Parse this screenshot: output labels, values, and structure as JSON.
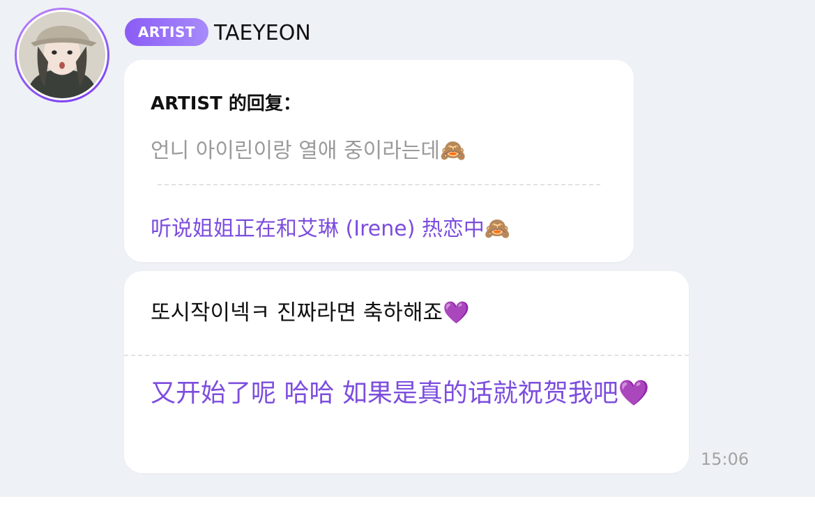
{
  "header": {
    "badge": "ARTIST",
    "name": "TAEYEON"
  },
  "reply": {
    "title": "ARTIST 的回复：",
    "original": "언니 아이린이랑 열애 중이라는데🙈",
    "translation": "听说姐姐正在和艾琳 (Irene) 热恋中🙈"
  },
  "message": {
    "original": "또시작이넥ㅋ 진짜라면 축하해죠💜",
    "translation": "又开始了呢 哈哈 如果是真的话就祝贺我吧💜",
    "time": "15:06"
  },
  "colors": {
    "badge_start": "#8b5cf6",
    "badge_end": "#a78bfa",
    "translation": "#7c4dde",
    "background": "#eef1f5"
  }
}
